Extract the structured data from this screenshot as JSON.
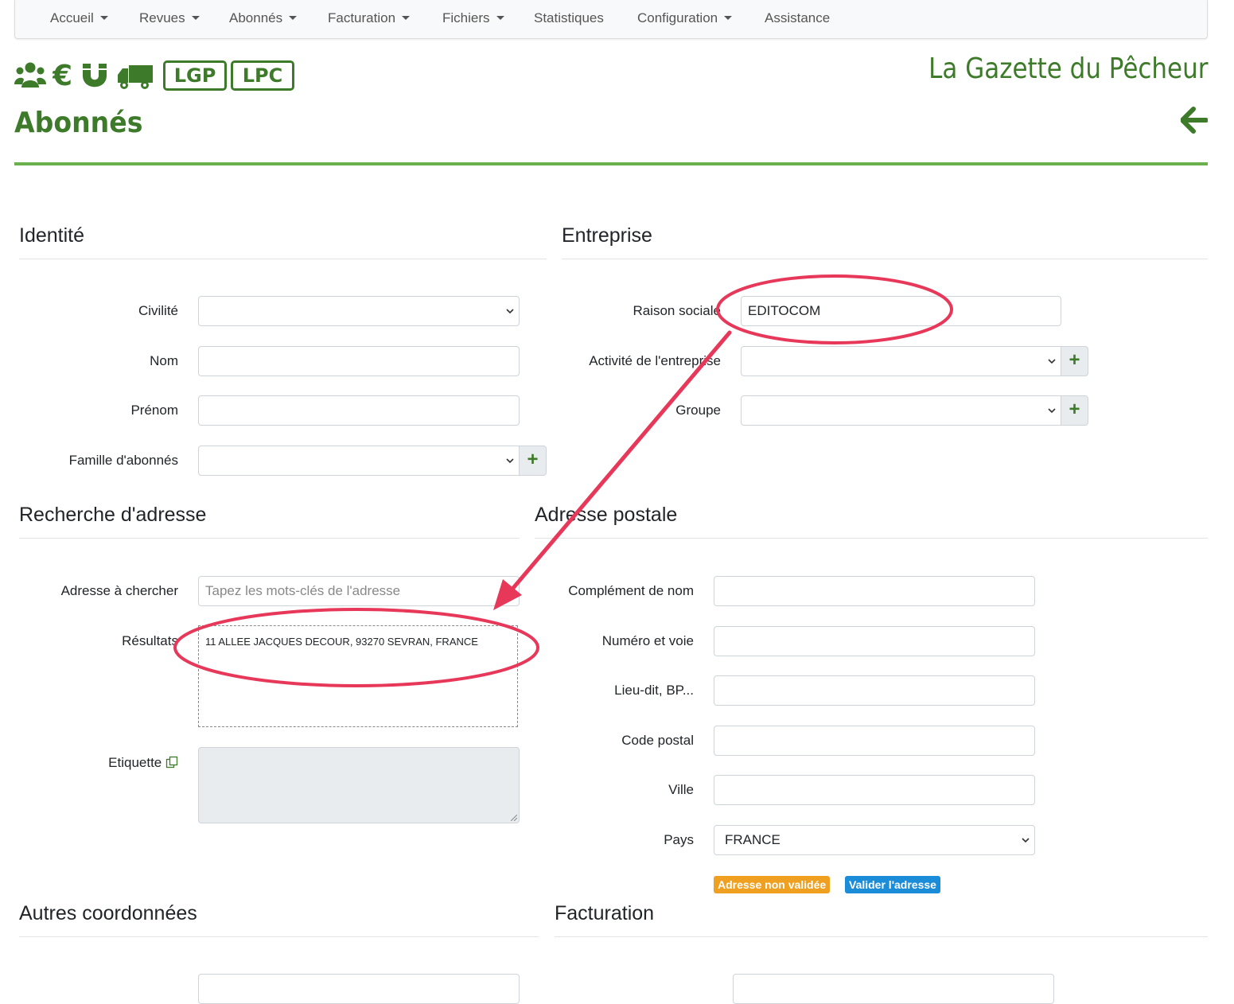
{
  "navbar": {
    "items": [
      {
        "label": "Accueil",
        "dropdown": true
      },
      {
        "label": "Revues",
        "dropdown": true
      },
      {
        "label": "Abonnés",
        "dropdown": true
      },
      {
        "label": "Facturation",
        "dropdown": true
      },
      {
        "label": "Fichiers",
        "dropdown": true
      },
      {
        "label": "Statistiques",
        "dropdown": false
      },
      {
        "label": "Configuration",
        "dropdown": true
      },
      {
        "label": "Assistance",
        "dropdown": false
      }
    ]
  },
  "toolbar": {
    "icons": [
      "users-icon",
      "euro-icon",
      "magnet-icon",
      "truck-icon"
    ],
    "tags": [
      "LGP",
      "LPC"
    ]
  },
  "brand": "La Gazette du Pêcheur",
  "page_title": "Abonnés",
  "colors": {
    "brand_green": "#3d7a2a",
    "rule_green": "#6ab04c",
    "annotation_red": "#e8385a",
    "badge_orange": "#f0a020",
    "badge_blue": "#1a8cd8"
  },
  "identite": {
    "title": "Identité",
    "civilite_label": "Civilité",
    "civilite_value": "",
    "nom_label": "Nom",
    "nom_value": "",
    "prenom_label": "Prénom",
    "prenom_value": "",
    "famille_label": "Famille d'abonnés",
    "famille_value": ""
  },
  "entreprise": {
    "title": "Entreprise",
    "raison_label": "Raison sociale",
    "raison_value": "EDITOCOM",
    "activite_label": "Activité de l'entreprise",
    "activite_value": "",
    "groupe_label": "Groupe",
    "groupe_value": ""
  },
  "recherche": {
    "title": "Recherche d'adresse",
    "adresse_label": "Adresse à chercher",
    "adresse_placeholder": "Tapez les mots-clés de l'adresse",
    "resultats_label": "Résultats",
    "result_1": "11 ALLEE JACQUES DECOUR, 93270 SEVRAN, FRANCE",
    "etiquette_label": "Etiquette"
  },
  "postale": {
    "title": "Adresse postale",
    "complement_label": "Complément de nom",
    "numero_label": "Numéro et voie",
    "lieudit_label": "Lieu-dit, BP...",
    "cp_label": "Code postal",
    "ville_label": "Ville",
    "pays_label": "Pays",
    "pays_value": "FRANCE",
    "badge_not_validated": "Adresse non validée",
    "validate_button": "Valider l'adresse"
  },
  "autres": {
    "title": "Autres coordonnées"
  },
  "facturation": {
    "title": "Facturation"
  }
}
